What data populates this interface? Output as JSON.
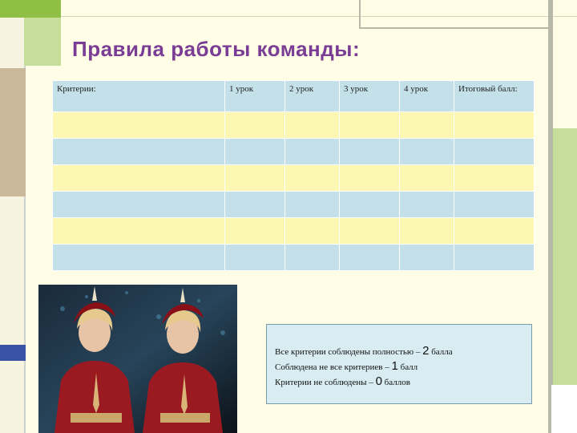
{
  "title": "Правила работы команды:",
  "table": {
    "headers": [
      "Критерии:",
      "1 урок",
      "2 урок",
      "3 урок",
      "4 урок",
      "Итоговый балл:"
    ],
    "rows": [
      {
        "style": "yellow",
        "cells": [
          "",
          "",
          "",
          "",
          "",
          ""
        ]
      },
      {
        "style": "blue",
        "cells": [
          "",
          "",
          "",
          "",
          "",
          ""
        ]
      },
      {
        "style": "yellow",
        "cells": [
          "",
          "",
          "",
          "",
          "",
          ""
        ]
      },
      {
        "style": "blue",
        "cells": [
          "",
          "",
          "",
          "",
          "",
          ""
        ]
      },
      {
        "style": "yellow",
        "cells": [
          "",
          "",
          "",
          "",
          "",
          ""
        ]
      },
      {
        "style": "blue",
        "cells": [
          "",
          "",
          "",
          "",
          "",
          ""
        ]
      }
    ]
  },
  "scoring": [
    {
      "before": "Все критерии соблюдены полностью – ",
      "num": "2",
      "after": " балла"
    },
    {
      "before": "Соблюдена не все критериев – ",
      "num": "1",
      "after": " балл"
    },
    {
      "before": "Критерии не соблюдены – ",
      "num": "0",
      "after": " баллов"
    }
  ],
  "colors": {
    "title": "#7a3d96",
    "row_yellow": "#fdf7b4",
    "row_blue": "#c4e1e9",
    "background": "#fffde6"
  }
}
